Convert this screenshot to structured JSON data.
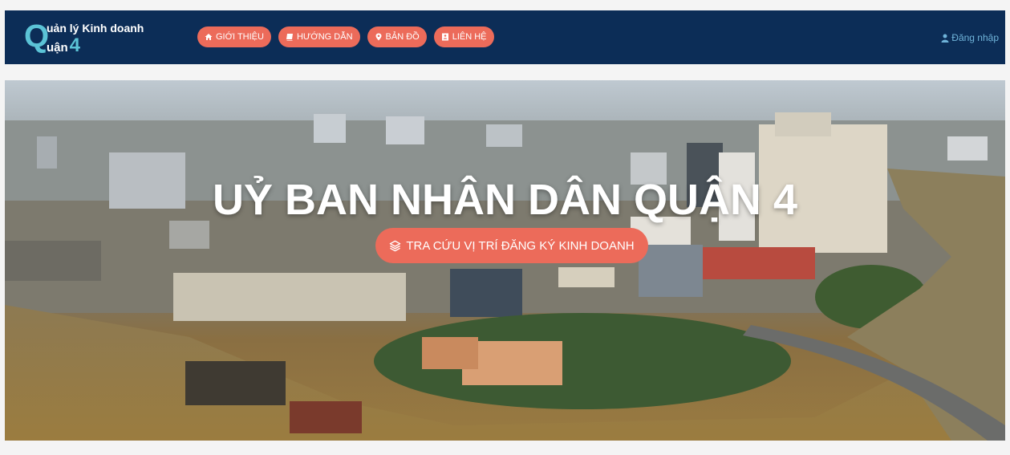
{
  "header": {
    "logo": {
      "line1": "uản lý Kinh doanh",
      "big_letter": "Q",
      "line2": "uận",
      "number": "4"
    },
    "nav": [
      {
        "label": "GIỚI THIỆU",
        "icon": "home-icon"
      },
      {
        "label": "HƯỚNG DẪN",
        "icon": "book-icon"
      },
      {
        "label": "BẢN ĐỒ",
        "icon": "map-marker-icon"
      },
      {
        "label": "LIÊN HỆ",
        "icon": "contact-card-icon"
      }
    ],
    "login_label": "Đăng nhập"
  },
  "hero": {
    "title": "UỶ BAN NHÂN DÂN QUẬN 4",
    "cta_label": "TRA CỨU VỊ TRÍ ĐĂNG KÝ KINH DOANH",
    "cta_icon": "layers-icon"
  },
  "colors": {
    "navbar": "#0c2d57",
    "accent": "#ec6b5a",
    "logo_cyan": "#5bc3d6",
    "login_text": "#6fb3d9"
  }
}
